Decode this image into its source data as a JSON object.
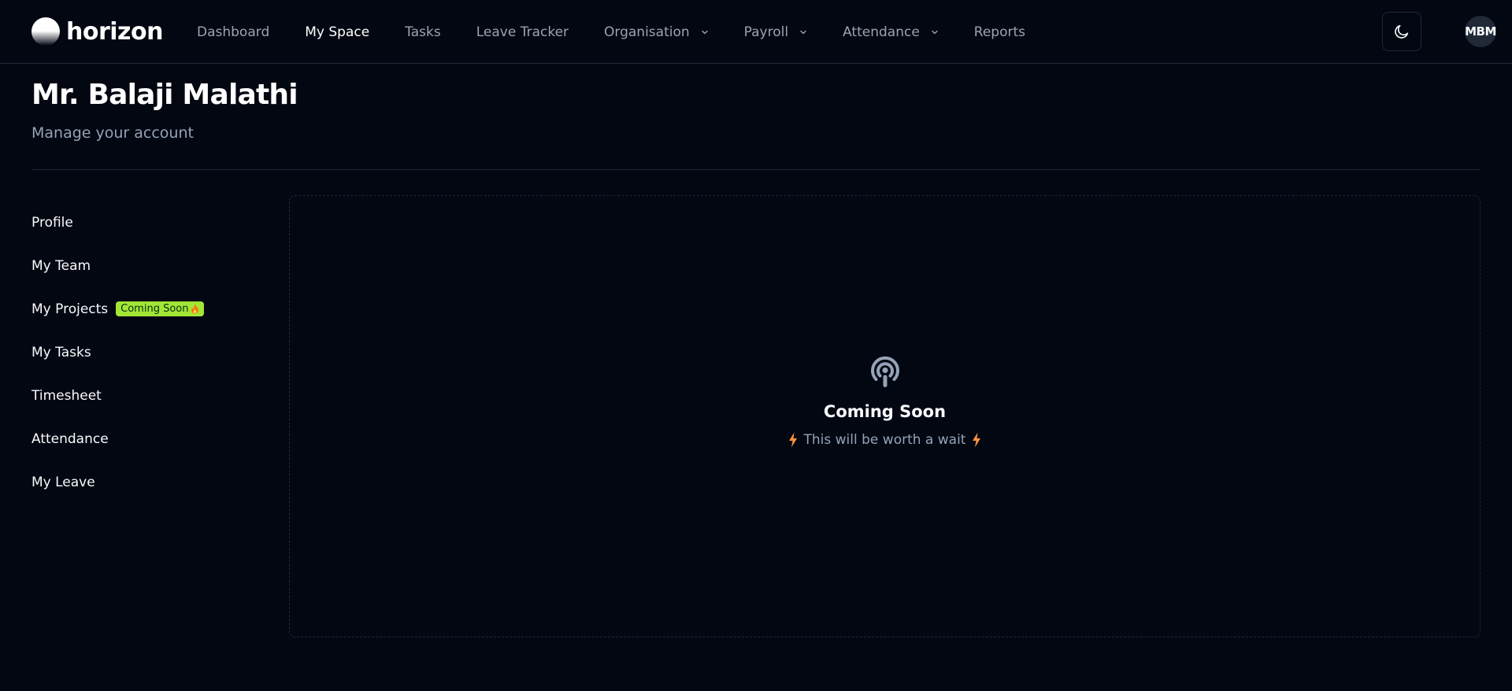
{
  "app": {
    "name": "horizon"
  },
  "nav": {
    "items": [
      {
        "label": "Dashboard",
        "active": false,
        "dropdown": false
      },
      {
        "label": "My Space",
        "active": true,
        "dropdown": false
      },
      {
        "label": "Tasks",
        "active": false,
        "dropdown": false
      },
      {
        "label": "Leave Tracker",
        "active": false,
        "dropdown": false
      },
      {
        "label": "Organisation",
        "active": false,
        "dropdown": true
      },
      {
        "label": "Payroll",
        "active": false,
        "dropdown": true
      },
      {
        "label": "Attendance",
        "active": false,
        "dropdown": true
      },
      {
        "label": "Reports",
        "active": false,
        "dropdown": false
      }
    ]
  },
  "header": {
    "theme_icon": "moon-icon",
    "avatar_initials": "MBM"
  },
  "page": {
    "title": "Mr. Balaji Malathi",
    "subtitle": "Manage your account"
  },
  "sidebar": {
    "items": [
      {
        "label": "Profile"
      },
      {
        "label": "My Team"
      },
      {
        "label": "My Projects",
        "badge": "Coming Soon"
      },
      {
        "label": "My Tasks"
      },
      {
        "label": "Timesheet"
      },
      {
        "label": "Attendance"
      },
      {
        "label": "My Leave"
      }
    ]
  },
  "main": {
    "icon": "podcast-icon",
    "title": "Coming Soon",
    "subtitle": "This will be worth a wait"
  },
  "colors": {
    "background": "#030712",
    "border": "#1f2937",
    "badge": "#a3e635",
    "bolt": "#fb923c"
  }
}
